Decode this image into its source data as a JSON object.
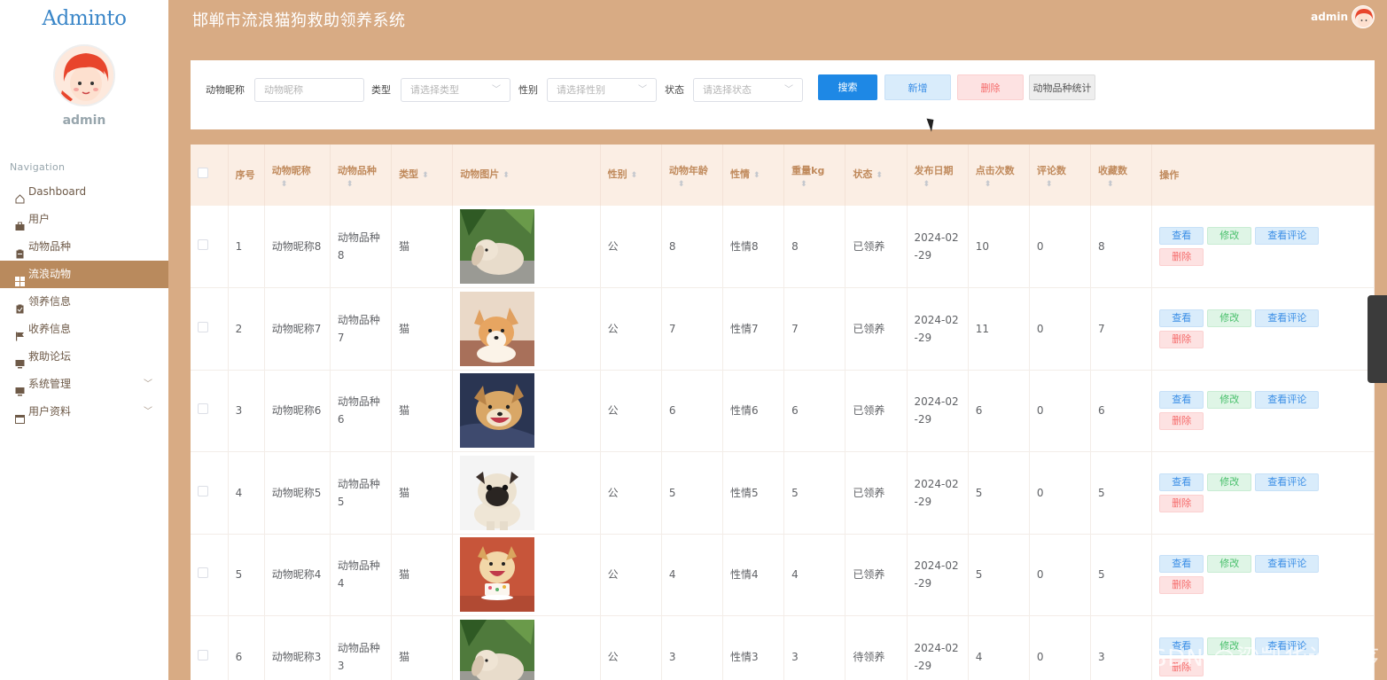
{
  "app": {
    "logo": "Adminto",
    "title": "邯郸市流浪猫狗救助领养系统",
    "user": "admin",
    "watermark": "CSDN @梁凯华设程序"
  },
  "sidebar": {
    "username": "admin",
    "heading": "Navigation",
    "items": [
      {
        "label": "Dashboard",
        "icon": "home-icon",
        "active": false,
        "expand": false
      },
      {
        "label": "用户",
        "icon": "briefcase-icon",
        "active": false,
        "expand": false
      },
      {
        "label": "动物品种",
        "icon": "clipboard-icon",
        "active": false,
        "expand": false
      },
      {
        "label": "流浪动物",
        "icon": "grid-icon",
        "active": true,
        "expand": false
      },
      {
        "label": "领养信息",
        "icon": "clipboard-check-icon",
        "active": false,
        "expand": false
      },
      {
        "label": "收养信息",
        "icon": "flag-icon",
        "active": false,
        "expand": false
      },
      {
        "label": "救助论坛",
        "icon": "monitor-icon",
        "active": false,
        "expand": false
      },
      {
        "label": "系统管理",
        "icon": "monitor-icon",
        "active": false,
        "expand": true
      },
      {
        "label": "用户资料",
        "icon": "calendar-icon",
        "active": false,
        "expand": true
      }
    ]
  },
  "search": {
    "fields": [
      {
        "label": "动物昵称",
        "placeholder": "动物昵称",
        "select": false
      },
      {
        "label": "类型",
        "placeholder": "请选择类型",
        "select": true
      },
      {
        "label": "性别",
        "placeholder": "请选择性别",
        "select": true
      },
      {
        "label": "状态",
        "placeholder": "请选择状态",
        "select": true
      }
    ],
    "buttons": {
      "search": "搜索",
      "add": "新增",
      "delete": "删除",
      "stats": "动物品种统计"
    }
  },
  "table": {
    "columns": [
      "序号",
      "动物昵称",
      "动物品种",
      "类型",
      "动物图片",
      "性别",
      "动物年龄",
      "性情",
      "重量kg",
      "状态",
      "发布日期",
      "点击次数",
      "评论数",
      "收藏数",
      "操作"
    ],
    "actions": {
      "view": "查看",
      "edit": "修改",
      "comments": "查看评论",
      "delete": "删除"
    },
    "rows": [
      {
        "index": "1",
        "nickname": "动物昵称8",
        "breed": "动物品种8",
        "type": "猫",
        "photo": "rabbit",
        "gender": "公",
        "age": "8",
        "temper": "性情8",
        "weight": "8",
        "status": "已领养",
        "date": "2024-02-29",
        "clicks": "10",
        "comments": "0",
        "favorites": "8"
      },
      {
        "index": "2",
        "nickname": "动物昵称7",
        "breed": "动物品种7",
        "type": "猫",
        "photo": "corgi",
        "gender": "公",
        "age": "7",
        "temper": "性情7",
        "weight": "7",
        "status": "已领养",
        "date": "2024-02-29",
        "clicks": "11",
        "comments": "0",
        "favorites": "7"
      },
      {
        "index": "3",
        "nickname": "动物昵称6",
        "breed": "动物品种6",
        "type": "猫",
        "photo": "smiling-dog",
        "gender": "公",
        "age": "6",
        "temper": "性情6",
        "weight": "6",
        "status": "已领养",
        "date": "2024-02-29",
        "clicks": "6",
        "comments": "0",
        "favorites": "6"
      },
      {
        "index": "4",
        "nickname": "动物昵称5",
        "breed": "动物品种5",
        "type": "猫",
        "photo": "pug",
        "gender": "公",
        "age": "5",
        "temper": "性情5",
        "weight": "5",
        "status": "已领养",
        "date": "2024-02-29",
        "clicks": "5",
        "comments": "0",
        "favorites": "5"
      },
      {
        "index": "5",
        "nickname": "动物昵称4",
        "breed": "动物品种4",
        "type": "猫",
        "photo": "puppy-cake",
        "gender": "公",
        "age": "4",
        "temper": "性情4",
        "weight": "4",
        "status": "已领养",
        "date": "2024-02-29",
        "clicks": "5",
        "comments": "0",
        "favorites": "5"
      },
      {
        "index": "6",
        "nickname": "动物昵称3",
        "breed": "动物品种3",
        "type": "猫",
        "photo": "rabbit",
        "gender": "公",
        "age": "3",
        "temper": "性情3",
        "weight": "3",
        "status": "待领养",
        "date": "2024-02-29",
        "clicks": "4",
        "comments": "0",
        "favorites": "3"
      }
    ]
  }
}
